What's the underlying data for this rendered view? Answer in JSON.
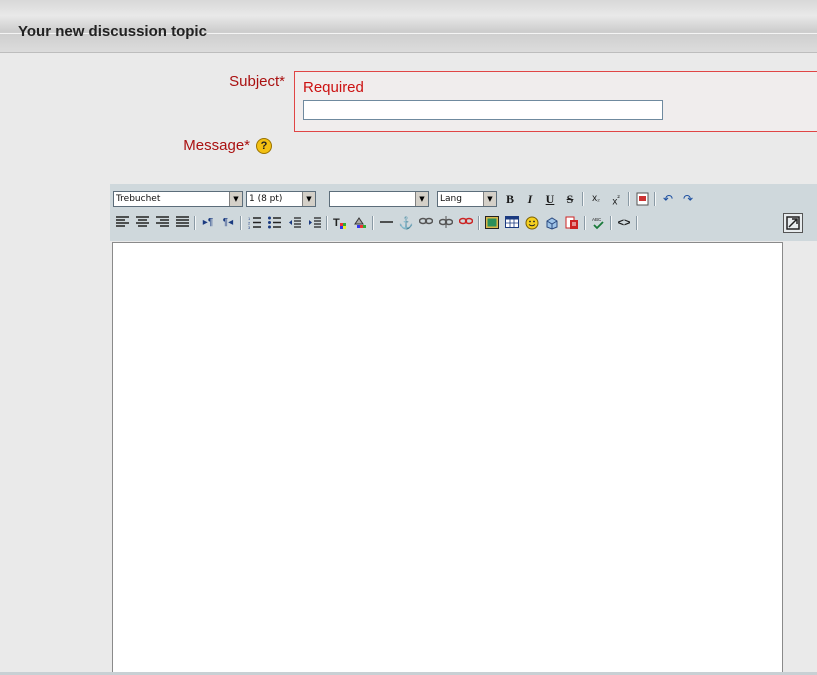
{
  "header": {
    "title": "Your new discussion topic"
  },
  "form": {
    "subject_label": "Subject*",
    "subject_required": "Required",
    "subject_value": "",
    "message_label": "Message*",
    "help_glyph": "?"
  },
  "toolbar": {
    "font_family": "Trebuchet",
    "font_size": "1 (8 pt)",
    "paragraph": "",
    "lang": "Lang",
    "bold_glyph": "B",
    "italic_glyph": "I",
    "underline_glyph": "U",
    "strike_glyph": "S",
    "icons_row1": [
      "bold-icon",
      "italic-icon",
      "underline-icon",
      "strikethrough-icon",
      "subscript-icon",
      "superscript-icon",
      "clean-word-icon",
      "undo-icon",
      "redo-icon"
    ],
    "icons_row2": [
      "align-left-icon",
      "align-center-icon",
      "align-right-icon",
      "align-justify-icon",
      "ltr-icon",
      "rtl-icon",
      "ordered-list-icon",
      "unordered-list-icon",
      "outdent-icon",
      "indent-icon",
      "text-color-icon",
      "highlight-color-icon",
      "horizontal-rule-icon",
      "anchor-icon",
      "link-icon",
      "unlink-icon",
      "nolink-icon",
      "image-icon",
      "table-icon",
      "smiley-icon",
      "special-char-icon",
      "search-replace-icon",
      "spellcheck-icon",
      "html-source-icon",
      "fullscreen-icon"
    ]
  },
  "colors": {
    "label_red": "#aa1111",
    "toolbar_bg": "#cfd8dc",
    "content_bg": "#eaeaea"
  }
}
